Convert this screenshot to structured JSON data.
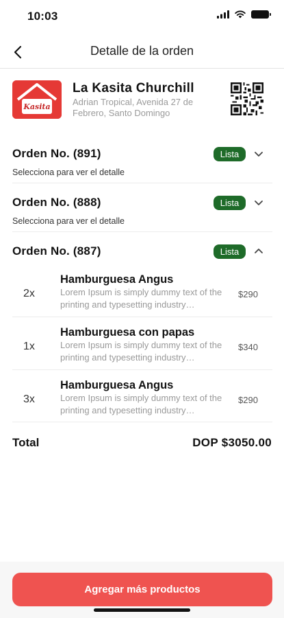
{
  "status_bar": {
    "time": "10:03",
    "icons": [
      "signal-icon",
      "wifi-icon",
      "battery-icon"
    ]
  },
  "nav": {
    "title": "Detalle de la orden",
    "back_icon": "chevron-left-icon"
  },
  "store": {
    "name": "La Kasita Churchill",
    "address": "Adrian Tropical, Avenida 27 de Febrero, Santo Domingo",
    "logo_text": "Kasita"
  },
  "orders": [
    {
      "title": "Orden No. (891)",
      "subtitle": "Selecciona para ver el detalle",
      "status": "Lista",
      "expanded": false
    },
    {
      "title": "Orden No. (888)",
      "subtitle": "Selecciona para ver el detalle",
      "status": "Lista",
      "expanded": false
    },
    {
      "title": "Orden No. (887)",
      "status": "Lista",
      "expanded": true
    }
  ],
  "products": [
    {
      "qty": "2x",
      "name": "Hamburguesa Angus",
      "description": "Lorem Ipsum is simply dummy text of the printing and typesetting industry…",
      "price": "$290"
    },
    {
      "qty": "1x",
      "name": "Hamburguesa con papas",
      "description": "Lorem Ipsum is simply dummy text of the printing and typesetting industry…",
      "price": "$340"
    },
    {
      "qty": "3x",
      "name": "Hamburguesa Angus",
      "description": "Lorem Ipsum is simply dummy text of the printing and typesetting industry…",
      "price": "$290"
    }
  ],
  "total": {
    "label": "Total",
    "value": "DOP $3050.00"
  },
  "cta": {
    "label": "Agregar más productos"
  },
  "colors": {
    "accent": "#ef5350",
    "badge": "#1e6b29",
    "logo_red": "#e53935"
  }
}
